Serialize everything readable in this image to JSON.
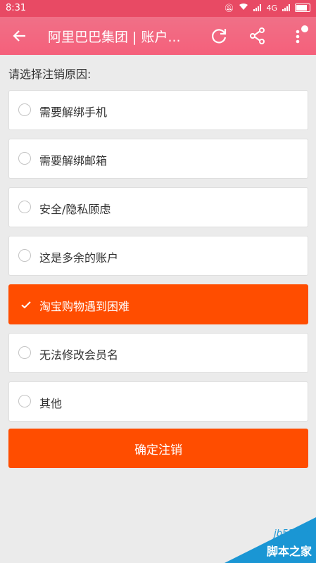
{
  "status_bar": {
    "time": "8:31",
    "network": "4G",
    "colors": {
      "bg": "#e84a64"
    }
  },
  "app_bar": {
    "title": "阿里巴巴集团 | 账户...",
    "back_icon": "back-arrow-icon",
    "refresh_icon": "refresh-icon",
    "share_icon": "share-icon",
    "more_icon": "more-vert-icon"
  },
  "page": {
    "prompt": "请选择注销原因:",
    "options": [
      {
        "label": "需要解绑手机",
        "selected": false
      },
      {
        "label": "需要解绑邮箱",
        "selected": false
      },
      {
        "label": "安全/隐私顾虑",
        "selected": false
      },
      {
        "label": "这是多余的账户",
        "selected": false
      },
      {
        "label": "淘宝购物遇到困难",
        "selected": true
      },
      {
        "label": "无法修改会员名",
        "selected": false
      },
      {
        "label": "其他",
        "selected": false
      }
    ],
    "confirm_label": "确定注销",
    "accent_color": "#ff4d00"
  },
  "watermark": {
    "url": "jb51.net",
    "brand": "脚本之家"
  }
}
